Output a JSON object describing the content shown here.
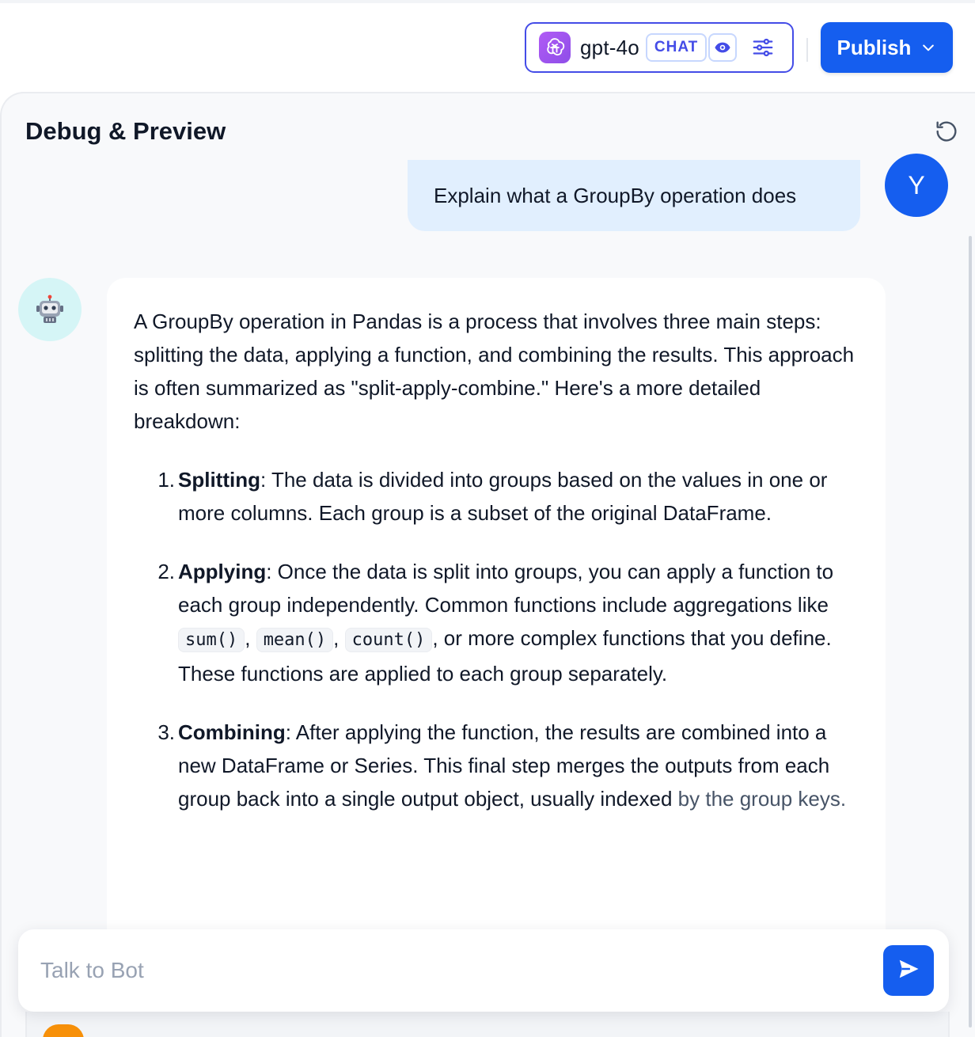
{
  "header": {
    "model_name": "gpt-4o",
    "model_mode": "CHAT",
    "publish_label": "Publish"
  },
  "panel": {
    "title": "Debug & Preview"
  },
  "messages": {
    "user": {
      "avatar_letter": "Y",
      "text": "Explain what a GroupBy operation does"
    },
    "bot": {
      "intro": "A GroupBy operation in Pandas is a process that involves three main steps: splitting the data, applying a function, and combining the results. This approach is often summarized as \"split-apply-combine.\" Here's a more detailed breakdown:",
      "items": [
        {
          "num": "1.",
          "term": "Splitting",
          "text": ": The data is divided into groups based on the values in one or more columns. Each group is a subset of the original DataFrame."
        },
        {
          "num": "2.",
          "term": "Applying",
          "text_a": ": Once the data is split into groups, you can apply a function to each group independently. Common functions include aggregations like ",
          "code_1": "sum()",
          "sep_1": ", ",
          "code_2": "mean()",
          "sep_2": ", ",
          "code_3": "count()",
          "text_b": ", or more complex functions that you define. These functions are applied to each group separately."
        },
        {
          "num": "3.",
          "term": "Combining",
          "text": ": After applying the function, the results are combined into a new DataFrame or Series. This final step merges the outputs from each group back into a single output object, usually indexed",
          "text_faded": "by the group keys."
        }
      ]
    }
  },
  "input": {
    "placeholder": "Talk to Bot",
    "value": ""
  },
  "colors": {
    "accent": "#155eef",
    "model_border": "#444ce7",
    "user_bubble": "#e1effe",
    "bot_avatar_bg": "#d5f5f6"
  }
}
